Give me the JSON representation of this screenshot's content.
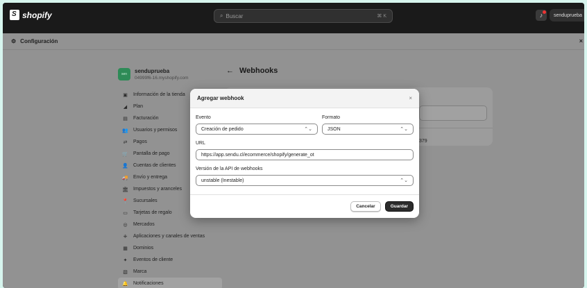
{
  "topbar": {
    "brand": "shopify",
    "search_placeholder": "Buscar",
    "search_shortcut": "⌘ K",
    "user": "senduprueba"
  },
  "config": {
    "title": "Configuración",
    "close": "×"
  },
  "store": {
    "avatar": "sen",
    "name": "senduprueba",
    "url": "04999f6-16.myshopify.com"
  },
  "sidebar": {
    "items": [
      {
        "label": "Información de la tienda",
        "icon": "store-icon",
        "glyph": "▣"
      },
      {
        "label": "Plan",
        "icon": "chart-icon",
        "glyph": "◢"
      },
      {
        "label": "Facturación",
        "icon": "receipt-icon",
        "glyph": "▤"
      },
      {
        "label": "Usuarios y permisos",
        "icon": "users-icon",
        "glyph": "👥"
      },
      {
        "label": "Pagos",
        "icon": "payments-icon",
        "glyph": "⇄"
      },
      {
        "label": "Pantalla de pago",
        "icon": "cart-icon",
        "glyph": "🛒"
      },
      {
        "label": "Cuentas de clientes",
        "icon": "person-icon",
        "glyph": "👤"
      },
      {
        "label": "Envío y entrega",
        "icon": "truck-icon",
        "glyph": "🚚"
      },
      {
        "label": "Impuestos y aranceles",
        "icon": "tax-icon",
        "glyph": "🏛"
      },
      {
        "label": "Sucursales",
        "icon": "location-icon",
        "glyph": "📍"
      },
      {
        "label": "Tarjetas de regalo",
        "icon": "gift-card-icon",
        "glyph": "▭"
      },
      {
        "label": "Mercados",
        "icon": "globe-icon",
        "glyph": "◎"
      },
      {
        "label": "Aplicaciones y canales de ventas",
        "icon": "apps-icon",
        "glyph": "⁜"
      },
      {
        "label": "Dominios",
        "icon": "domain-icon",
        "glyph": "▦"
      },
      {
        "label": "Eventos de cliente",
        "icon": "events-icon",
        "glyph": "✦"
      },
      {
        "label": "Marca",
        "icon": "brand-icon",
        "glyph": "▧"
      },
      {
        "label": "Notificaciones",
        "icon": "bell-icon",
        "glyph": "🔔"
      }
    ]
  },
  "page": {
    "back": "←",
    "title": "Webhooks",
    "partial_number": "379"
  },
  "modal": {
    "title": "Agregar webhook",
    "close": "×",
    "event_label": "Evento",
    "event_value": "Creación de pedido",
    "format_label": "Formato",
    "format_value": "JSON",
    "url_label": "URL",
    "url_value": "https://app.sendu.cl/ecommerce/shopify/generate_ot",
    "version_label": "Versión de la API de webhooks",
    "version_value": "unstable (Inestable)",
    "cancel": "Cancelar",
    "save": "Guardar"
  }
}
